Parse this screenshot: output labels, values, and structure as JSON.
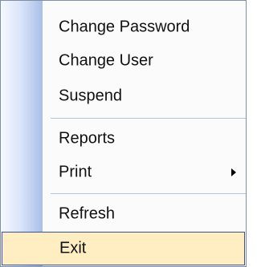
{
  "menu": {
    "items": [
      {
        "label": "Change Password"
      },
      {
        "label": "Change User"
      },
      {
        "label": "Suspend"
      },
      {
        "label": "Reports"
      },
      {
        "label": "Print"
      },
      {
        "label": "Refresh"
      },
      {
        "label": "Exit"
      }
    ],
    "submenu_icon": "chevron-right-icon",
    "selected_item": "Exit",
    "colors": {
      "gutter_start": "#f5f8ff",
      "gutter_end": "#a9bfe8",
      "selected_bg": "#ffeec2",
      "selected_border": "#3b4fa2",
      "separator": "#b8c3d6"
    }
  }
}
